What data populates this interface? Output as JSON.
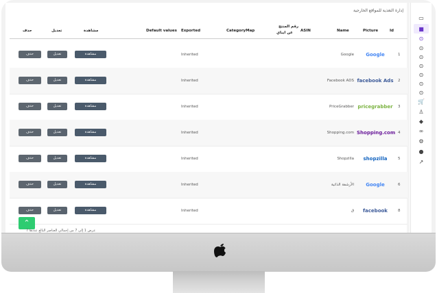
{
  "breadcrumb": "إدارة التغذية للمواقع الخارجية",
  "columns": {
    "id": "Id",
    "picture": "Picture",
    "name": "Name",
    "asin": "ASIN",
    "product_code": "رقم المنتج",
    "product_code2": "عن ايباي",
    "category_map": "CategoryMap",
    "exported": "Exported",
    "default_values": "Default values",
    "view": "مشاهدة",
    "edit": "تعديل",
    "delete": "حذف"
  },
  "buttons": {
    "view": "مشاهدة",
    "edit": "تعديل",
    "delete": "حذف"
  },
  "rows": [
    {
      "id": "1",
      "name": "Google",
      "exported": "Inherited",
      "logo": "Google",
      "logo_kind": "google"
    },
    {
      "id": "2",
      "name": "Facebook ADS",
      "exported": "Inherited",
      "logo": "facebook Ads",
      "logo_kind": "facebook"
    },
    {
      "id": "3",
      "name": "PriceGrabber",
      "exported": "Inherited",
      "logo": "pricegrabber",
      "logo_kind": "pricegrabber"
    },
    {
      "id": "4",
      "name": "Shopping.com",
      "exported": "Inherited",
      "logo": "Shopping.com",
      "logo_kind": "shopping"
    },
    {
      "id": "5",
      "name": "Shopzilla",
      "exported": "Inherited",
      "logo": "shopzilla",
      "logo_kind": "shopzilla"
    },
    {
      "id": "6",
      "name": "الأرشفة الذاتية",
      "exported": "Inherited",
      "logo": "Google",
      "logo_kind": "google"
    },
    {
      "id": "8",
      "name": "ق",
      "exported": "Inherited",
      "logo": "facebook",
      "logo_kind": "facebook-multi"
    }
  ],
  "footer": "عرض 1 إلى 7 من إجمالي العناصر البالغ عددها 7",
  "colors": {
    "accent": "#6a37c9",
    "scroll_top": "#2ecc71",
    "btn": "#4a5a6b"
  },
  "icons": [
    "monitor-icon",
    "page-icon",
    "circle-icon",
    "circle-icon",
    "circle-icon",
    "circle-icon",
    "circle-icon",
    "circle-icon",
    "circle-icon",
    "cart-icon",
    "user-icon",
    "tag-icon",
    "link-icon",
    "gears-icon",
    "globe-icon",
    "chart-icon"
  ]
}
